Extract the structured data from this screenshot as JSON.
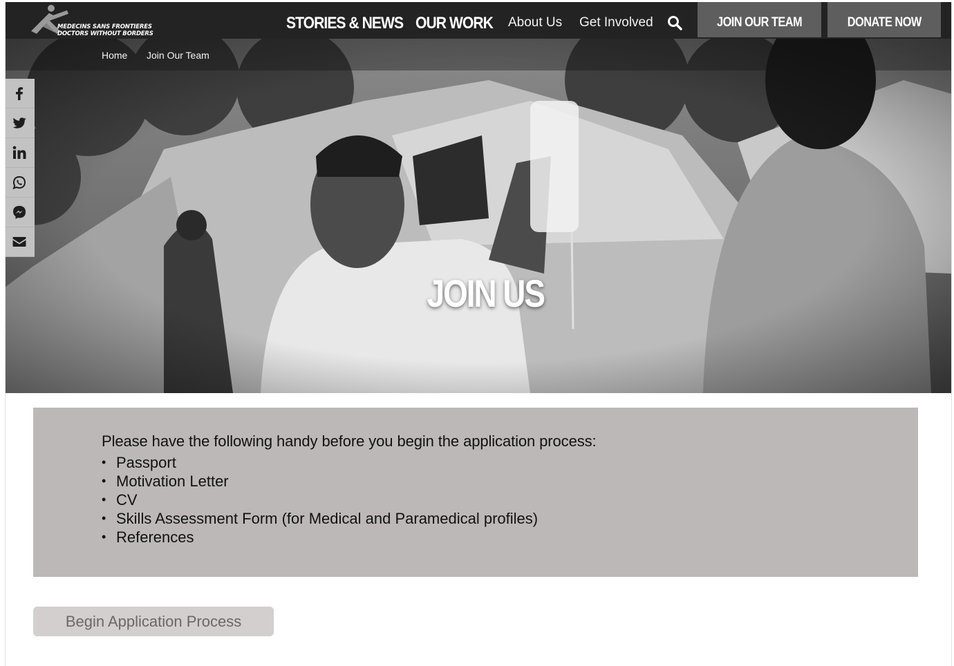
{
  "header": {
    "logo": {
      "line1": "MEDECINS SANS FRONTIERES",
      "line2": "DOCTORS WITHOUT BORDERS",
      "icon": "msf-logo-icon"
    },
    "nav": {
      "stories": "STORIES & NEWS",
      "work": "OUR WORK",
      "about": "About Us",
      "involved": "Get Involved"
    },
    "search_icon": "search-icon",
    "join_team": "JOIN OUR TEAM",
    "donate": "DONATE NOW"
  },
  "breadcrumb": {
    "home": "Home",
    "current": "Join Our Team"
  },
  "hero": {
    "title": "JOIN US"
  },
  "share": [
    {
      "name": "facebook",
      "icon": "facebook-icon"
    },
    {
      "name": "twitter",
      "icon": "twitter-icon"
    },
    {
      "name": "linkedin",
      "icon": "linkedin-icon"
    },
    {
      "name": "whatsapp",
      "icon": "whatsapp-icon"
    },
    {
      "name": "messenger",
      "icon": "messenger-icon"
    },
    {
      "name": "email",
      "icon": "email-icon"
    }
  ],
  "info": {
    "intro": "Please have the following handy before you begin the application process:",
    "bullet": "•",
    "items": [
      "Passport",
      "Motivation Letter",
      "CV",
      "Skills Assessment Form (for Medical and Paramedical profiles)",
      "References"
    ]
  },
  "begin_button": "Begin Application Process",
  "colors": {
    "header_bg": "#232323",
    "cta_bg": "#5e5e5e",
    "panel_bg": "#bdb8b8",
    "button_bg": "#d3cfcf",
    "share_bg": "#c2c2c2"
  }
}
